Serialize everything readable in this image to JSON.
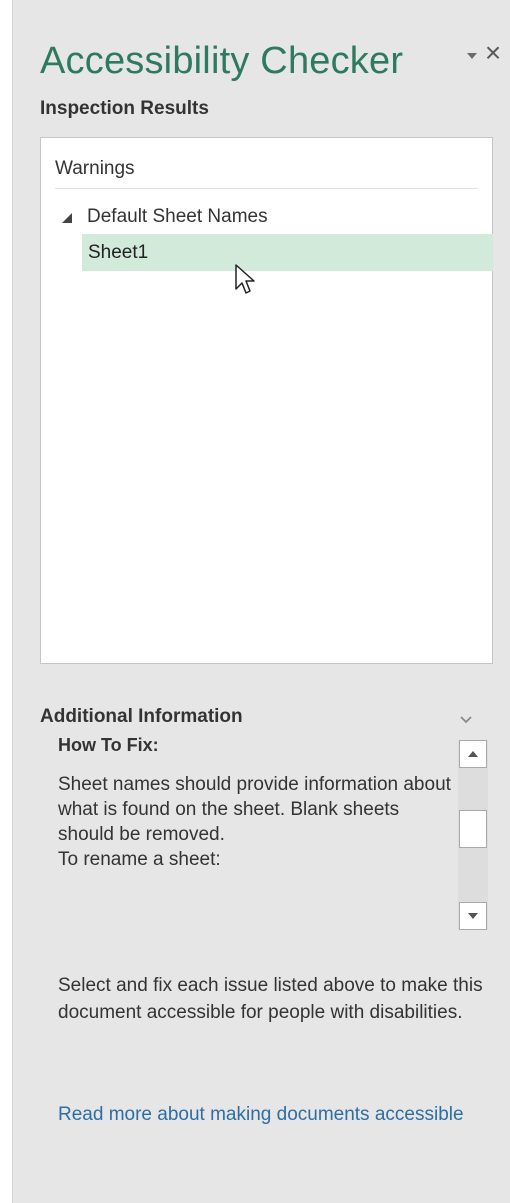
{
  "pane": {
    "title": "Accessibility Checker",
    "close_glyph": "×",
    "options_icon": "dropdown-triangle-icon",
    "close_icon": "close-icon"
  },
  "inspection": {
    "heading": "Inspection Results",
    "category_label": "Warnings",
    "groups": [
      {
        "label": "Default Sheet Names",
        "expanded": true,
        "items": [
          {
            "label": "Sheet1",
            "selected": true
          }
        ]
      }
    ]
  },
  "additional_info": {
    "heading": "Additional Information",
    "how_to_fix_heading": "How To Fix:",
    "paragraphs": [
      "Sheet names should provide information about what is found on the sheet. Blank sheets should be removed.",
      "To rename a sheet:"
    ]
  },
  "footer": {
    "instructions": "Select and fix each issue listed above to make this document accessible for people with disabilities.",
    "link_text": "Read more about making documents accessible"
  },
  "colors": {
    "title_green": "#2e7a5f",
    "selected_row": "#d1ead9",
    "pane_background": "#e6e6e6",
    "link_blue": "#2e6da4"
  }
}
